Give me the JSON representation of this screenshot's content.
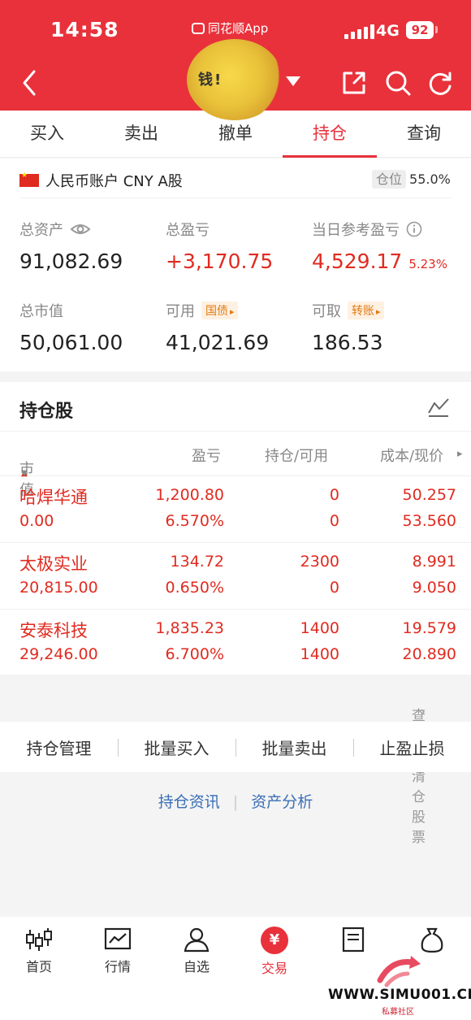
{
  "status_bar": {
    "time": "14:58",
    "app_name": "同花顺App",
    "network": "4G",
    "battery": "92"
  },
  "header": {
    "account_blob_text": "钱!"
  },
  "tabs": [
    {
      "label": "买入",
      "active": false
    },
    {
      "label": "卖出",
      "active": false
    },
    {
      "label": "撤单",
      "active": false
    },
    {
      "label": "持仓",
      "active": true
    },
    {
      "label": "查询",
      "active": false
    }
  ],
  "account": {
    "name": "人民币账户 CNY A股",
    "position_label": "仓位",
    "position_value": "55.0%"
  },
  "metrics": {
    "total_assets": {
      "label": "总资产",
      "value": "91,082.69"
    },
    "total_pnl": {
      "label": "总盈亏",
      "value": "+3,170.75"
    },
    "today_pnl": {
      "label": "当日参考盈亏",
      "value": "4,529.17",
      "pct": "5.23%"
    },
    "market_value": {
      "label": "总市值",
      "value": "50,061.00"
    },
    "available": {
      "label": "可用",
      "chip": "国债",
      "value": "41,021.69"
    },
    "withdrawable": {
      "label": "可取",
      "chip": "转账",
      "value": "186.53"
    }
  },
  "holdings": {
    "title": "持仓股",
    "columns": [
      "市值",
      "盈亏",
      "持仓/可用",
      "成本/现价"
    ],
    "rows": [
      {
        "name": "哈焊华通",
        "market_value": "0.00",
        "pnl": "1,200.80",
        "pnl_pct": "6.570%",
        "holding": "0",
        "available": "0",
        "cost": "50.257",
        "price": "53.560"
      },
      {
        "name": "太极实业",
        "market_value": "20,815.00",
        "pnl": "134.72",
        "pnl_pct": "0.650%",
        "holding": "2300",
        "available": "0",
        "cost": "8.991",
        "price": "9.050"
      },
      {
        "name": "安泰科技",
        "market_value": "29,246.00",
        "pnl": "1,835.23",
        "pnl_pct": "6.700%",
        "holding": "1400",
        "available": "1400",
        "cost": "19.579",
        "price": "20.890"
      }
    ],
    "view_cleared": "查看已清仓股票"
  },
  "actions": [
    "持仓管理",
    "批量买入",
    "批量卖出",
    "止盈止损"
  ],
  "links": [
    "持仓资讯",
    "资产分析"
  ],
  "bottom_nav": [
    {
      "label": "首页",
      "icon": "candlestick-icon"
    },
    {
      "label": "行情",
      "icon": "chart-icon"
    },
    {
      "label": "自选",
      "icon": "user-icon"
    },
    {
      "label": "交易",
      "icon": "yuan-icon",
      "active": true
    },
    {
      "label": "资讯",
      "icon": "document-icon"
    },
    {
      "label": "理财",
      "icon": "money-bag-icon"
    }
  ],
  "watermark": {
    "text": "WWW.SIMU001.CN",
    "sub": "私募社区"
  },
  "colors": {
    "brand_red": "#e8313b",
    "gain_red": "#e02b20",
    "link_blue": "#3a6fb5",
    "chip_orange": "#e07a12"
  }
}
